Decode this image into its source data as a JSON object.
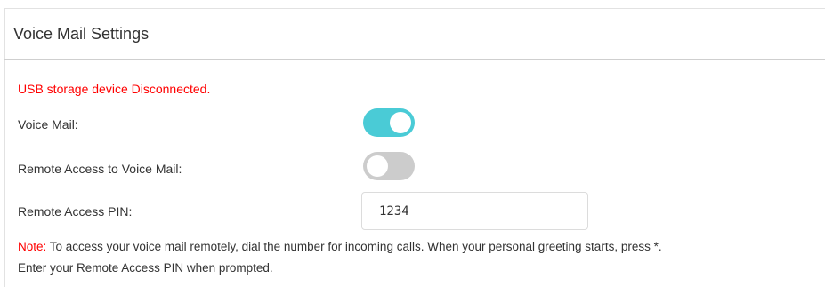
{
  "section": {
    "title": "Voice Mail Settings"
  },
  "status_message": "USB storage device Disconnected.",
  "voice_mail": {
    "label": "Voice Mail:",
    "enabled": true
  },
  "remote_access": {
    "label": "Remote Access to Voice Mail:",
    "enabled": false
  },
  "remote_pin": {
    "label": "Remote Access PIN:",
    "value": "1234"
  },
  "note": {
    "prefix": "Note:",
    "line1": " To access your voice mail remotely, dial the number for incoming calls. When your personal greeting starts, press *.",
    "line2": "Enter your Remote Access PIN when prompted."
  },
  "colors": {
    "toggle_on": "#4acbd6",
    "toggle_off": "#cccccc",
    "status_red": "#ff0000",
    "text": "#333333"
  }
}
